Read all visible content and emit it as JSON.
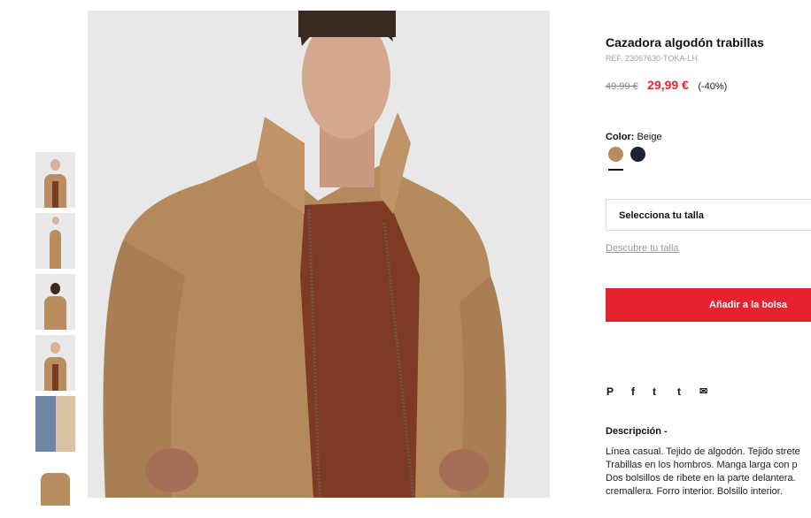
{
  "product": {
    "title": "Cazadora algodón trabillas",
    "ref": "REF. 23067630-TOKA-LH",
    "old_price": "49,99 €",
    "new_price": "29,99 €",
    "discount": "(-40%)",
    "color_label": "Color:",
    "color_value": "Beige",
    "swatches": [
      {
        "name": "Beige",
        "color": "#b88c5c"
      },
      {
        "name": "Navy",
        "color": "#1b2433"
      }
    ],
    "size_select": "Selecciona tu talla",
    "size_guide": "Descubre tu talla",
    "add_to_bag": "Añadir a la bolsa"
  },
  "share": {
    "pinterest": "P",
    "facebook": "f",
    "twitter": "t",
    "tumblr": "t",
    "email": "✉"
  },
  "description": {
    "title": "Descripción -",
    "lines": [
      "Línea casual. Tejido de algodón. Tejido strete",
      "Trabillas en los hombros. Manga larga con p",
      "Dos bolsillos de ribete en la parte delantera.",
      "cremallera. Forro interior. Bolsillo interior."
    ]
  },
  "colors": {
    "accent_red": "#e4232f",
    "price_red": "#e4252f"
  }
}
